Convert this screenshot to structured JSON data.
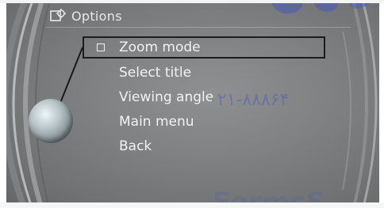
{
  "header": {
    "title": "Options",
    "icon": "options-gear-icon"
  },
  "menu": {
    "items": [
      {
        "label": "Zoom mode",
        "selected": true,
        "icon": "checkbox-icon"
      },
      {
        "label": "Select title",
        "selected": false
      },
      {
        "label": "Viewing angle",
        "selected": false
      },
      {
        "label": "Main menu",
        "selected": false
      },
      {
        "label": "Back",
        "selected": false
      }
    ]
  },
  "watermark": {
    "digits": "۰۲۱-۸۸۸۶۴",
    "bottom_text": "FormsS"
  },
  "colors": {
    "screen_background": "#7d7f80",
    "text": "#f2f2f2",
    "selection_border": "#1c1c1c",
    "watermark": "#465abe"
  }
}
